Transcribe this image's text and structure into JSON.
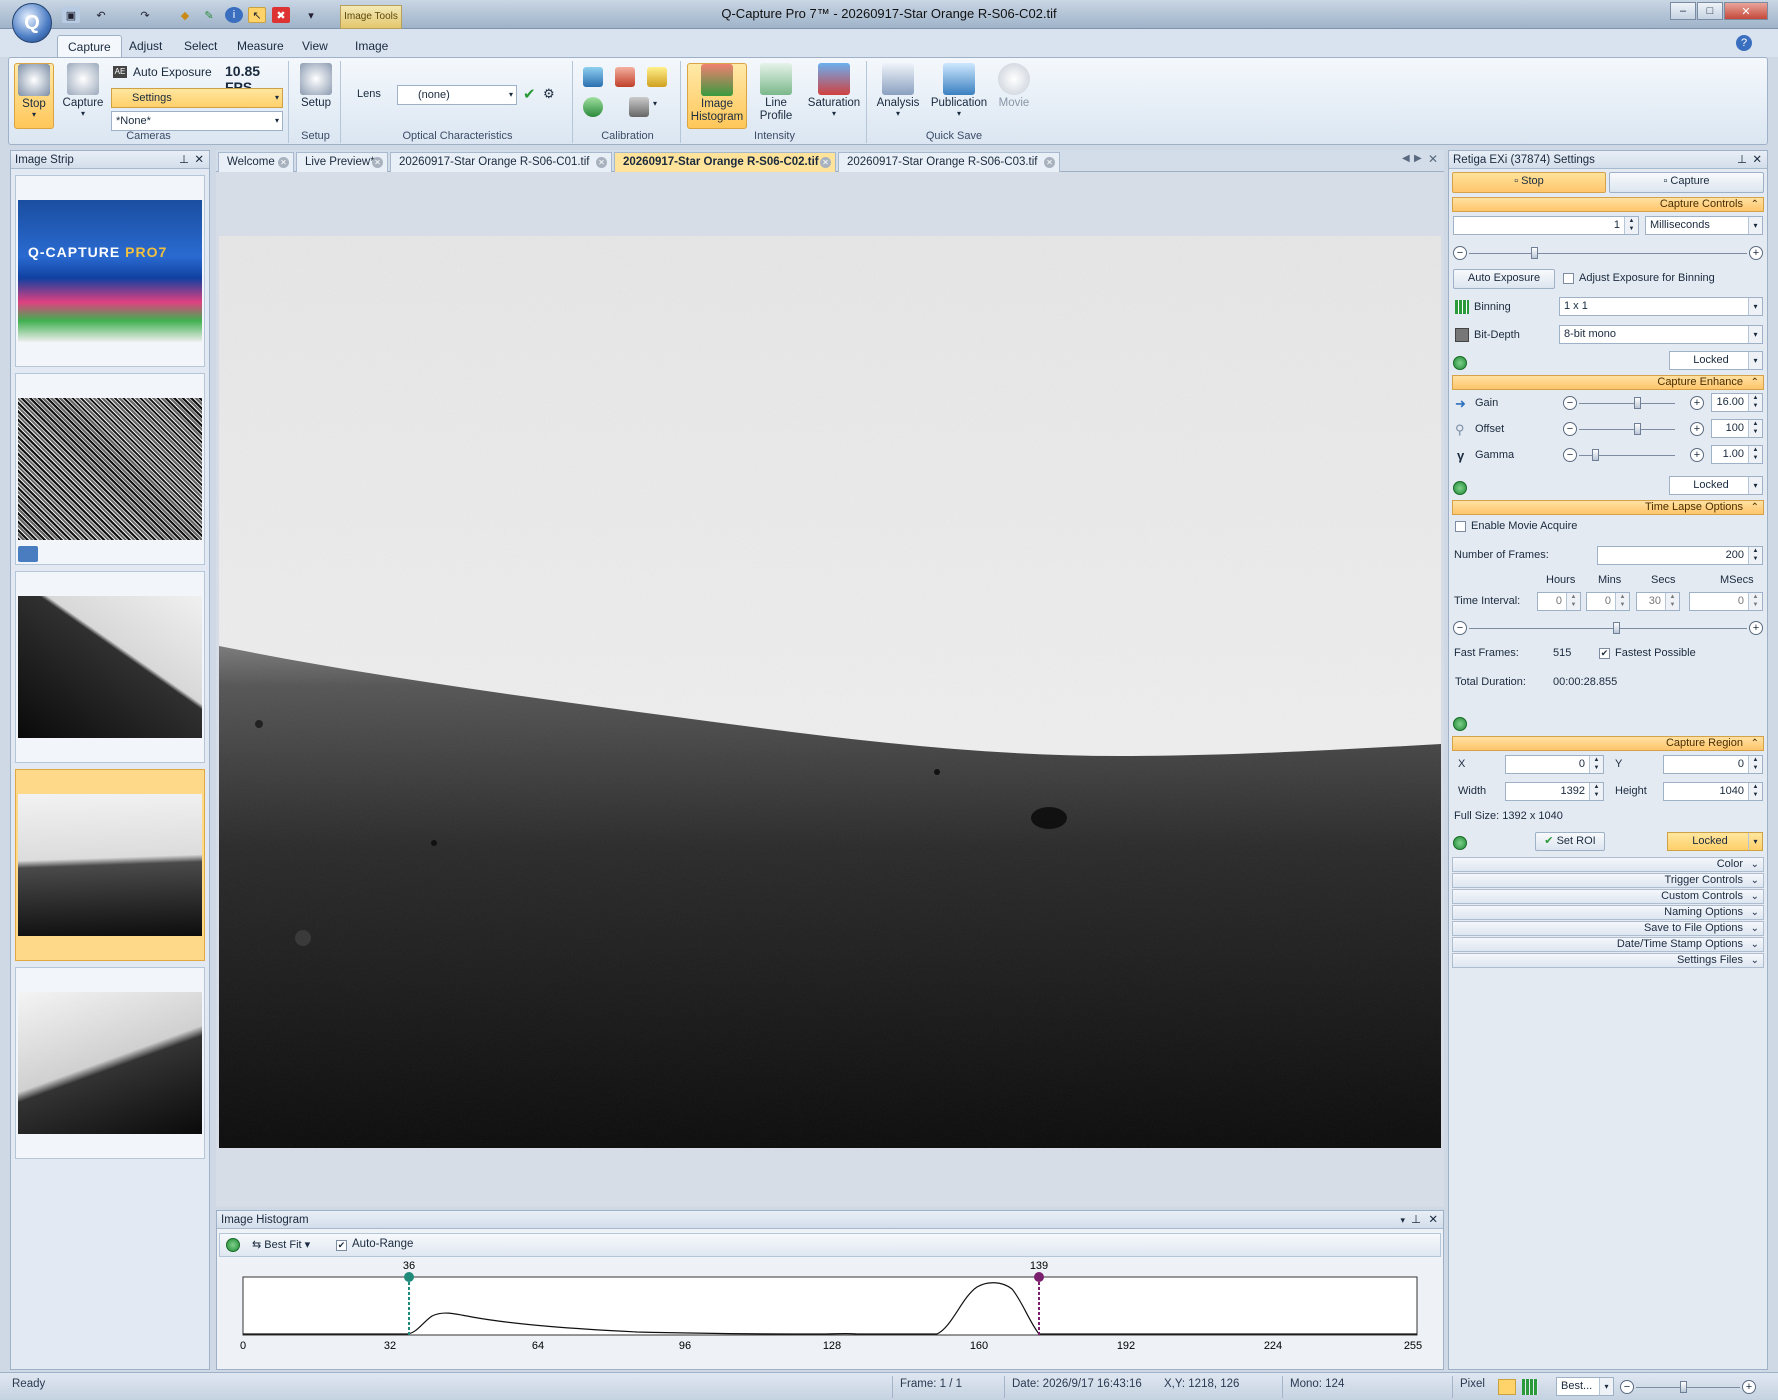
{
  "window": {
    "title": "Q-Capture Pro 7™ - 20260917-Star Orange R-S06-C02.tif",
    "image_tools_label": "Image Tools"
  },
  "ribbon": {
    "tabs": [
      "Capture",
      "Adjust",
      "Select",
      "Measure",
      "View",
      "Image"
    ],
    "active_tab": "Capture",
    "cameras": {
      "stop": "Stop",
      "capture": "Capture",
      "auto_exposure": "Auto Exposure",
      "fps": "10.85 FPS",
      "settings": "Settings",
      "preset": "*None*",
      "group": "Cameras"
    },
    "setup": {
      "label": "Setup",
      "group": "Setup"
    },
    "optical": {
      "lens_label": "Lens",
      "lens_value": "(none)",
      "group": "Optical Characteristics"
    },
    "calibration": {
      "group": "Calibration"
    },
    "intensity": {
      "image_histogram": "Image Histogram",
      "line_profile": "Line Profile",
      "saturation": "Saturation",
      "group": "Intensity"
    },
    "quicksave": {
      "analysis": "Analysis",
      "publication": "Publication",
      "movie": "Movie",
      "group": "Quick Save"
    }
  },
  "image_strip": {
    "title": "Image Strip"
  },
  "doc_tabs": [
    "Welcome",
    "Live Preview*",
    "20260917-Star Orange R-S06-C01.tif",
    "20260917-Star Orange R-S06-C02.tif",
    "20260917-Star Orange R-S06-C03.tif"
  ],
  "active_doc_tab": "20260917-Star Orange R-S06-C02.tif",
  "histogram": {
    "title": "Image Histogram",
    "best_fit": "Best Fit",
    "auto_range": "Auto-Range",
    "low_marker": "36",
    "high_marker": "139",
    "axis_ticks": [
      "0",
      "32",
      "64",
      "96",
      "128",
      "160",
      "192",
      "224",
      "255"
    ]
  },
  "settings_panel": {
    "title": "Retiga EXi (37874) Settings",
    "stop": "Stop",
    "capture": "Capture",
    "capture_controls": {
      "header": "Capture Controls",
      "exposure_value": "1",
      "exposure_unit": "Milliseconds",
      "auto_exposure": "Auto Exposure",
      "adjust_binning": "Adjust Exposure for Binning",
      "binning_label": "Binning",
      "binning_value": "1 x 1",
      "bitdepth_label": "Bit-Depth",
      "bitdepth_value": "8-bit mono",
      "locked": "Locked"
    },
    "capture_enhance": {
      "header": "Capture Enhance",
      "gain_label": "Gain",
      "gain_value": "16.00",
      "offset_label": "Offset",
      "offset_value": "100",
      "gamma_label": "Gamma",
      "gamma_value": "1.00",
      "locked": "Locked"
    },
    "time_lapse": {
      "header": "Time Lapse Options",
      "enable_movie": "Enable Movie Acquire",
      "frames_label": "Number of  Frames:",
      "frames_value": "200",
      "hours_label": "Hours",
      "mins_label": "Mins",
      "secs_label": "Secs",
      "msecs_label": "MSecs",
      "interval_label": "Time Interval:",
      "hours": "0",
      "mins": "0",
      "secs": "30",
      "msecs": "0",
      "fast_frames_label": "Fast Frames:",
      "fast_frames_value": "515",
      "fastest_possible": "Fastest Possible",
      "total_duration_label": "Total Duration:",
      "total_duration_value": "00:00:28.855"
    },
    "capture_region": {
      "header": "Capture Region",
      "x_label": "X",
      "x_value": "0",
      "y_label": "Y",
      "y_value": "0",
      "width_label": "Width",
      "width_value": "1392",
      "height_label": "Height",
      "height_value": "1040",
      "full_size": "Full Size: 1392 x 1040",
      "set_roi": "Set ROI",
      "locked": "Locked"
    },
    "collapsed_sections": [
      "Color",
      "Trigger Controls",
      "Custom Controls",
      "Naming Options",
      "Save to File Options",
      "Date/Time Stamp Options",
      "Settings Files"
    ]
  },
  "status": {
    "ready": "Ready",
    "frame": "Frame: 1 / 1",
    "date": "Date: 2026/9/17 16:43:16",
    "xy": "X,Y: 1218,  126",
    "mono": "Mono:  124",
    "pixel": "Pixel",
    "zoom": "Best..."
  },
  "colors": {
    "accent_orange": "#ffc56c",
    "ribbon_blue": "#dbe6f2",
    "histogram_low": "#1f8a7a",
    "histogram_high": "#7a1f6e"
  }
}
